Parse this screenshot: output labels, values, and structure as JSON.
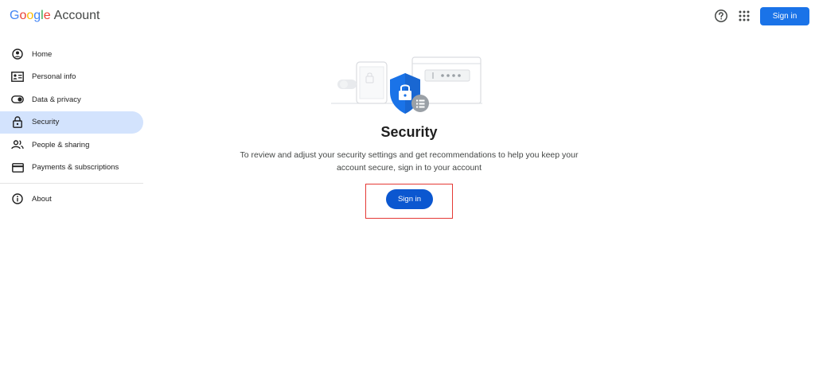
{
  "header": {
    "logo_google": "Google",
    "logo_account": "Account",
    "signin_label": "Sign in"
  },
  "sidebar": {
    "items": [
      {
        "label": "Home",
        "icon": "home-icon"
      },
      {
        "label": "Personal info",
        "icon": "person-card-icon"
      },
      {
        "label": "Data & privacy",
        "icon": "toggle-icon"
      },
      {
        "label": "Security",
        "icon": "lock-icon",
        "active": true
      },
      {
        "label": "People & sharing",
        "icon": "people-icon"
      },
      {
        "label": "Payments & subscriptions",
        "icon": "credit-card-icon"
      }
    ],
    "about_label": "About"
  },
  "main": {
    "title": "Security",
    "description": "To review and adjust your security settings and get recommendations to help you keep your account secure, sign in to your account",
    "signin_label": "Sign in"
  },
  "colors": {
    "primary_blue": "#1a73e8",
    "signin_blue": "#0b57d0",
    "active_bg": "#d3e3fd",
    "highlight_red": "#e53935"
  }
}
